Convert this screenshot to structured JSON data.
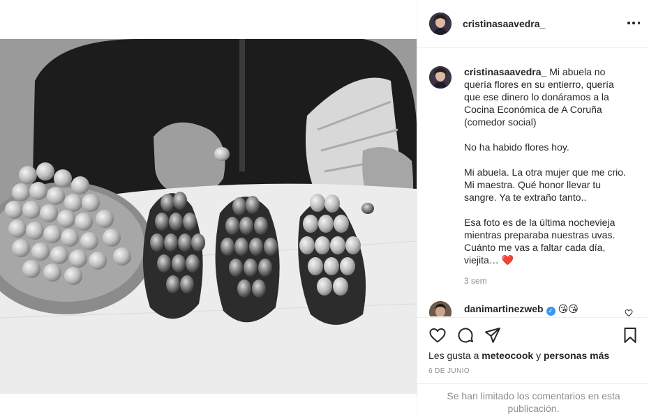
{
  "post": {
    "username": "cristinasaavedra_",
    "caption_paragraphs": [
      "Mi abuela no quería flores en su entierro, quería que ese dinero lo donáramos a la Cocina Económica de A Coruña (comedor social)",
      "No ha habido flores hoy.",
      "Mi abuela. La otra mujer que me crio. Mi maestra. Qué honor llevar tu sangre. Ya te extraño tanto..",
      "Esa foto es de la última nochevieja mientras preparaba nuestras uvas. Cuánto me vas a faltar cada día, viejita… "
    ],
    "heart_emoji": "❤️",
    "time_ago": "3 sem"
  },
  "comment": {
    "username": "danimartinezweb",
    "verified_mark": "✓",
    "emojis": "😘😘"
  },
  "actions": {
    "likes_prefix": "Les gusta a",
    "likes_user": "meteocook",
    "likes_connector": "y",
    "likes_others": "personas más",
    "date": "6 DE JUNIO",
    "comments_limited": "Se han limitado los comentarios en esta publicación."
  },
  "icons": [
    "more-options-icon",
    "like-icon",
    "comment-icon",
    "share-icon",
    "save-icon",
    "comment-like-icon"
  ],
  "colors": {
    "verified": "#3897f0",
    "secondary_text": "#8e8e8e",
    "border": "#efefef",
    "heart": "#e0162b"
  }
}
